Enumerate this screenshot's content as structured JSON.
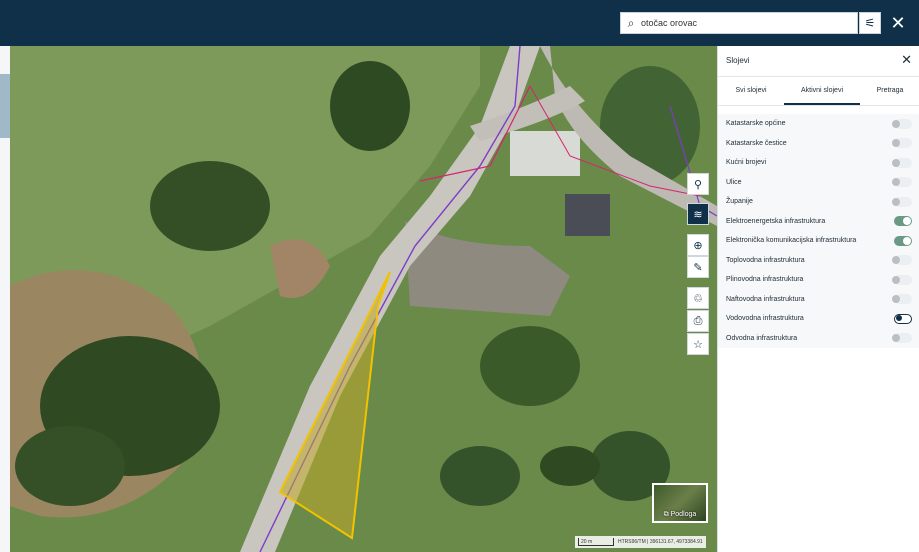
{
  "header": {
    "search_value": "otočac orovac",
    "search_icon": "search-icon",
    "filter_icon": "filter-icon",
    "close_icon": "close-icon"
  },
  "map": {
    "tools": [
      {
        "name": "location-pin-icon",
        "glyph": "⚲"
      },
      {
        "name": "layers-icon",
        "glyph": "≋"
      },
      {
        "name": "zoom-search-icon",
        "glyph": "⊕"
      },
      {
        "name": "ruler-icon",
        "glyph": "✎"
      },
      {
        "name": "recycle-icon",
        "glyph": "♲"
      },
      {
        "name": "print-icon",
        "glyph": "⎙"
      },
      {
        "name": "star-icon",
        "glyph": "☆"
      }
    ],
    "basemap_label": "⧉ Podloga",
    "scale_label": "20 m",
    "coords": "HTRS96/TM | 396131.67, 4973384.91"
  },
  "panel": {
    "title": "Slojevi",
    "tabs": [
      {
        "label": "Svi slojevi",
        "selected": false
      },
      {
        "label": "Aktivni slojevi",
        "selected": true
      },
      {
        "label": "Pretraga",
        "selected": false
      }
    ],
    "layers": [
      {
        "label": "Katastarske općine",
        "state": "off"
      },
      {
        "label": "Katastarske čestice",
        "state": "off"
      },
      {
        "label": "Kućni brojevi",
        "state": "off"
      },
      {
        "label": "Ulice",
        "state": "off"
      },
      {
        "label": "Županije",
        "state": "off"
      },
      {
        "label": "Elektroenergetska infrastruktura",
        "state": "on"
      },
      {
        "label": "Elektronička komunikacijska infrastruktura",
        "state": "on"
      },
      {
        "label": "Toplovodna infrastruktura",
        "state": "off"
      },
      {
        "label": "Plinovodna infrastruktura",
        "state": "off"
      },
      {
        "label": "Naftovodna infrastruktura",
        "state": "off"
      },
      {
        "label": "Vodovodna infrastruktura",
        "state": "focus"
      },
      {
        "label": "Odvodna infrastruktura",
        "state": "off"
      }
    ]
  },
  "colors": {
    "header": "#0f3048",
    "toggle_on": "#6a9a84",
    "parcel_outline": "#f2c200"
  }
}
